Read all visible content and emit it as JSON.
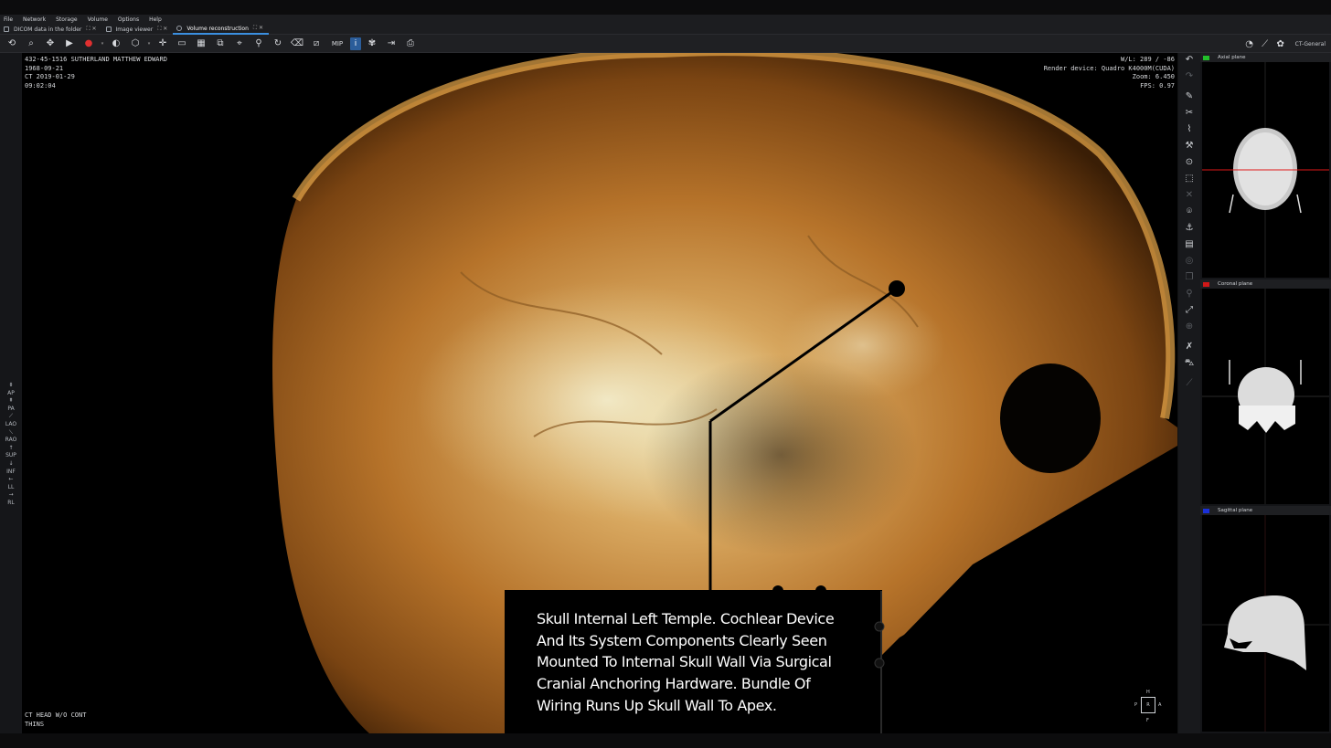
{
  "menu": [
    "File",
    "Network",
    "Storage",
    "Volume",
    "Options",
    "Help"
  ],
  "tabs": [
    {
      "label": "DICOM data in the folder"
    },
    {
      "label": "Image viewer"
    },
    {
      "label": "Volume reconstruction"
    }
  ],
  "toolbar": {
    "mip_label": "MIP",
    "info_label": "i",
    "preset": "CT-General"
  },
  "orientation_buttons": [
    "AP",
    "PA",
    "LAO",
    "RAO",
    "SUP",
    "INF",
    "LL",
    "RL"
  ],
  "viewport": {
    "top_left": [
      "432-45-1516 SUTHERLAND MATTHEW EDWARD",
      "1968-09-21",
      "CT 2019-01-29",
      "09:02:04"
    ],
    "top_right": [
      "W/L: 289 / -86",
      "Render device: Quadro K4000M(CUDA)",
      "Zoom: 6.450",
      "FPS: 0.97"
    ],
    "bottom_left": [
      "CT HEAD W/O CONT",
      "THINS"
    ],
    "caption": "Skull Internal Left Temple. Cochlear Device And Its System Components Clearly Seen Mounted To Internal Skull Wall Via Surgical Cranial Anchoring Hardware. Bundle Of Wiring Runs Up Skull Wall To Apex.",
    "cube": {
      "top": "H",
      "bottom": "F",
      "left": "P",
      "right": "A",
      "center": "R"
    }
  },
  "panels": [
    {
      "title": "Axial plane",
      "color": "#22c02a"
    },
    {
      "title": "Coronal plane",
      "color": "#d01818"
    },
    {
      "title": "Sagittal plane",
      "color": "#1a30d8"
    }
  ]
}
